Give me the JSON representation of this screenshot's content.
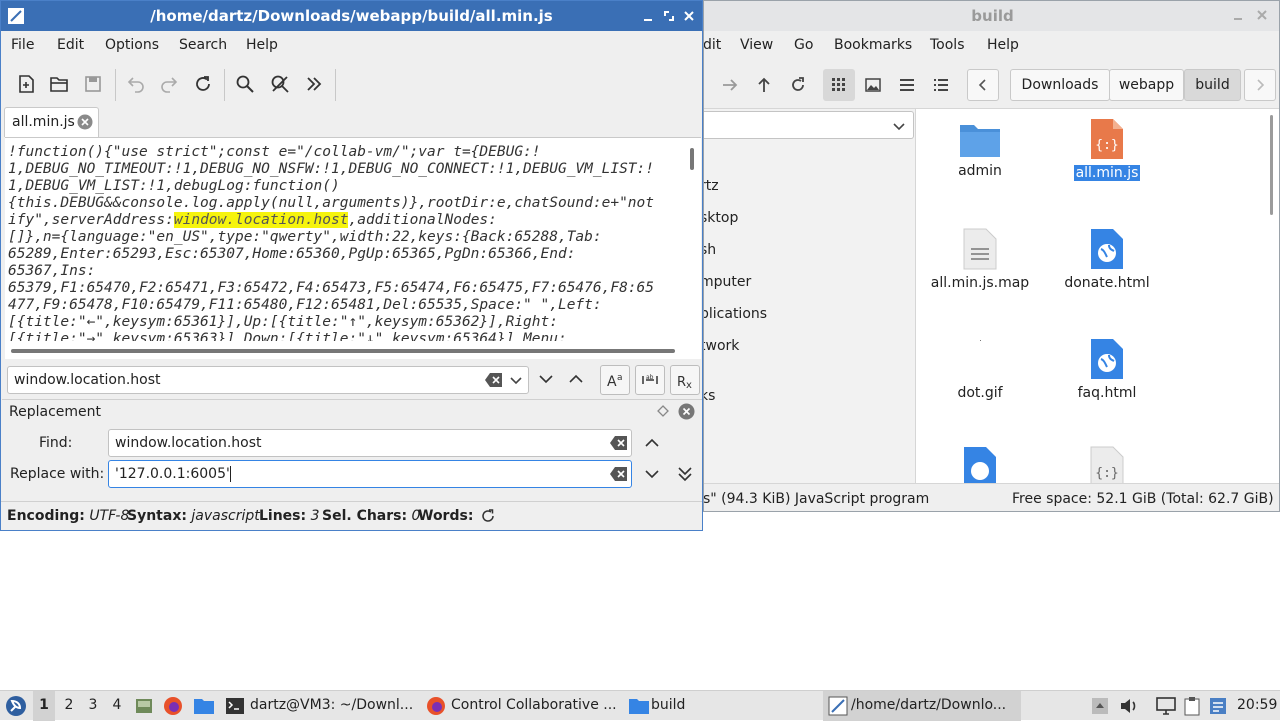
{
  "editor": {
    "title": "/home/dartz/Downloads/webapp/build/all.min.js",
    "menu": [
      "File",
      "Edit",
      "Options",
      "Search",
      "Help"
    ],
    "tab_label": "all.min.js",
    "code_lines": [
      [
        "!function(){\"use strict\";const e=\"/collab-vm/\";var t={DEBUG:!"
      ],
      [
        "1,DEBUG_NO_TIMEOUT:!1,DEBUG_NO_NSFW:!1,DEBUG_NO_CONNECT:!1,DEBUG_VM_LIST:!"
      ],
      [
        "1,DEBUG_VM_LIST:!1,debugLog:function()"
      ],
      [
        "{this.DEBUG&&console.log.apply(null,arguments)},rootDir:e,chatSound:e+\"not"
      ],
      [
        "ify\",serverAddress:",
        "window.location.host",
        ",additionalNodes:"
      ],
      [
        "[]},n={language:\"en_US\",type:\"qwerty\",width:22,keys:{Back:65288,Tab:"
      ],
      [
        "65289,Enter:65293,Esc:65307,Home:65360,PgUp:65365,PgDn:65366,End:"
      ],
      [
        "65367,Ins:"
      ],
      [
        "65379,F1:65470,F2:65471,F3:65472,F4:65473,F5:65474,F6:65475,F7:65476,F8:65"
      ],
      [
        "477,F9:65478,F10:65479,F11:65480,F12:65481,Del:65535,Space:\" \",Left:"
      ],
      [
        "[{title:\"←\",keysym:65361}],Up:[{title:\"↑\",keysym:65362}],Right:"
      ],
      [
        "[{title:\"→\",keysym:65363}],Down:[{title:\"↓\",keysym:65364}],Menu:"
      ]
    ],
    "search_value": "window.location.host",
    "replacement_heading": "Replacement",
    "find_label": "Find:",
    "find_value": "window.location.host",
    "replace_label": "Replace with:",
    "replace_value": "'127.0.0.1:6005'",
    "status": {
      "encoding_label": "Encoding:",
      "encoding_value": "UTF-8",
      "syntax_label": "Syntax:",
      "syntax_value": "javascript",
      "lines_label": "Lines:",
      "lines_value": "3",
      "sel_label": "Sel. Chars:",
      "sel_value": "0",
      "words_label": "Words:"
    }
  },
  "filemanager": {
    "title": "build",
    "menu": [
      "dit",
      "View",
      "Go",
      "Bookmarks",
      "Tools",
      "Help"
    ],
    "breadcrumbs": [
      "Downloads",
      "webapp",
      "build"
    ],
    "places": [
      "rtz",
      "sktop",
      "sh",
      "mputer",
      "plications",
      "twork",
      "ks"
    ],
    "items": [
      {
        "name": "admin",
        "icon": "folder-icon",
        "selected": false
      },
      {
        "name": "all.min.js",
        "icon": "javascript-file-icon",
        "selected": true
      },
      {
        "name": "all.min.js.map",
        "icon": "text-file-icon",
        "selected": false
      },
      {
        "name": "donate.html",
        "icon": "html-file-icon",
        "selected": false
      },
      {
        "name": "dot.gif",
        "icon": "image-file-icon",
        "selected": false
      },
      {
        "name": "faq.html",
        "icon": "html-file-icon",
        "selected": false
      }
    ],
    "status_left": "s\" (94.3 KiB) JavaScript program",
    "status_right": "Free space: 52.1 GiB (Total: 62.7 GiB)"
  },
  "taskbar": {
    "workspaces": [
      "1",
      "2",
      "3",
      "4"
    ],
    "tasks": [
      "dartz@VM3: ~/Downl...",
      "Control Collaborative ...",
      "build",
      "/home/dartz/Downlo..."
    ],
    "clock": "20:59"
  },
  "colors": {
    "accent": "#3a6fb5",
    "highlight": "#f6f40d",
    "selection": "#3584e4",
    "folder": "#4a90d9",
    "js": "#e8794a"
  }
}
